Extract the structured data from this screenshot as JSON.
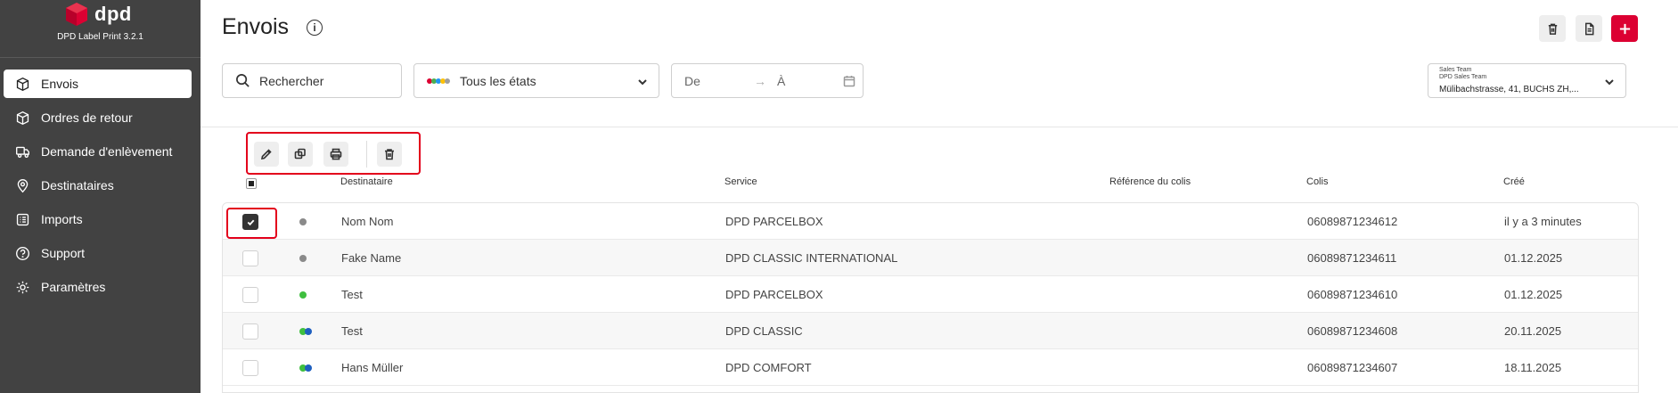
{
  "app": {
    "brand": "dpd",
    "version": "DPD Label Print 3.2.1",
    "brand_color": "#dc0032"
  },
  "sidebar": {
    "items": [
      {
        "label": "Envois",
        "icon": "box-icon",
        "active": true
      },
      {
        "label": "Ordres de retour",
        "icon": "box-return-icon",
        "active": false
      },
      {
        "label": "Demande d'enlèvement",
        "icon": "truck-icon",
        "active": false
      },
      {
        "label": "Destinataires",
        "icon": "location-pin-icon",
        "active": false
      },
      {
        "label": "Imports",
        "icon": "list-icon",
        "active": false
      },
      {
        "label": "Support",
        "icon": "help-circle-icon",
        "active": false
      },
      {
        "label": "Paramètres",
        "icon": "gear-icon",
        "active": false
      }
    ]
  },
  "header": {
    "title": "Envois",
    "info_icon": "info-icon",
    "buttons": [
      "trash-icon",
      "document-icon",
      "plus-icon"
    ]
  },
  "filters": {
    "search_placeholder": "Rechercher",
    "state_label": "Tous les états",
    "state_dot_colors": [
      "#dc0032",
      "#4caf50",
      "#2196f3",
      "#ffc107",
      "#9e9e9e"
    ],
    "date_from": "De",
    "date_arrow": "→",
    "date_to": "À",
    "account": {
      "line1": "Sales Team",
      "line2": "DPD Sales Team",
      "line3": "Mülibachstrasse, 41, BUCHS ZH,..."
    }
  },
  "toolbar": {
    "actions": [
      "pencil-icon",
      "duplicate-icon",
      "printer-icon",
      "trash-icon"
    ]
  },
  "table": {
    "columns": {
      "recipient": "Destinataire",
      "service": "Service",
      "reference": "Référence du colis",
      "parcel": "Colis",
      "created": "Créé"
    },
    "rows": [
      {
        "checked": true,
        "status_colors": [
          "#8a8a8a"
        ],
        "recipient": "Nom Nom",
        "service": "DPD PARCELBOX",
        "reference": "",
        "parcel": "06089871234612",
        "created": "il y a 3 minutes"
      },
      {
        "checked": false,
        "status_colors": [
          "#8a8a8a"
        ],
        "recipient": "Fake Name",
        "service": "DPD CLASSIC INTERNATIONAL",
        "reference": "",
        "parcel": "06089871234611",
        "created": "01.12.2025"
      },
      {
        "checked": false,
        "status_colors": [
          "#3fbf3f"
        ],
        "recipient": "Test",
        "service": "DPD PARCELBOX",
        "reference": "",
        "parcel": "06089871234610",
        "created": "01.12.2025"
      },
      {
        "checked": false,
        "status_colors": [
          "#3fbf3f",
          "#1e5fbf"
        ],
        "recipient": "Test",
        "service": "DPD CLASSIC",
        "reference": "",
        "parcel": "06089871234608",
        "created": "20.11.2025"
      },
      {
        "checked": false,
        "status_colors": [
          "#3fbf3f",
          "#1e5fbf"
        ],
        "recipient": "Hans Müller",
        "service": "DPD COMFORT",
        "reference": "",
        "parcel": "06089871234607",
        "created": "18.11.2025"
      }
    ]
  }
}
